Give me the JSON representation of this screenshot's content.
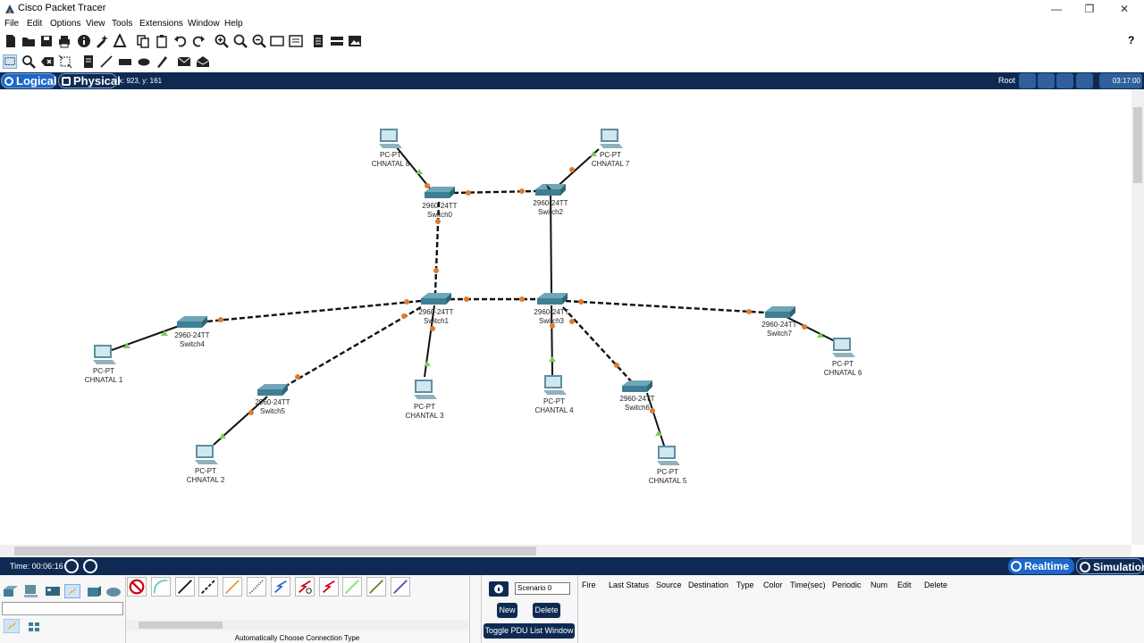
{
  "window": {
    "title": "Cisco Packet Tracer",
    "icon": "packet-tracer-icon",
    "controls": [
      "—",
      "❐",
      "✕"
    ]
  },
  "menu": [
    "File",
    "Edit",
    "Options",
    "View",
    "Tools",
    "Extensions",
    "Window",
    "Help"
  ],
  "viewbar": {
    "logical": "Logical",
    "physical": "Physical",
    "coords": "x: 923, y: 161",
    "root": "Root",
    "clock": "03:17:00"
  },
  "devices": {
    "switches": [
      {
        "model": "2960-24TT",
        "name": "Switch0"
      },
      {
        "model": "2960-24TT",
        "name": "Switch2"
      },
      {
        "model": "2960-24TT",
        "name": "Switch1"
      },
      {
        "model": "2960-24TT",
        "name": "Switch3"
      },
      {
        "model": "2960-24TT",
        "name": "Switch4"
      },
      {
        "model": "2960-24TT",
        "name": "Switch5"
      },
      {
        "model": "2960-24TT",
        "name": "Switch6"
      },
      {
        "model": "2960-24TT",
        "name": "Switch7"
      }
    ],
    "pcs": [
      {
        "model": "PC-PT",
        "name": "CHNATAL 8"
      },
      {
        "model": "PC-PT",
        "name": "CHNATAL 7"
      },
      {
        "model": "PC-PT",
        "name": "CHNATAL 1"
      },
      {
        "model": "PC-PT",
        "name": "CHNATAL 2"
      },
      {
        "model": "PC-PT",
        "name": "CHANTAL 3"
      },
      {
        "model": "PC-PT",
        "name": "CHANTAL 4"
      },
      {
        "model": "PC-PT",
        "name": "CHNATAL 5"
      },
      {
        "model": "PC-PT",
        "name": "CHNATAL 6"
      }
    ]
  },
  "timebar": {
    "time": "Time: 00:06:16",
    "realtime": "Realtime",
    "simulation": "Simulation"
  },
  "bottom": {
    "connection_label": "Automatically Choose Connection Type",
    "scenario": "Scenario 0",
    "new": "New",
    "delete": "Delete",
    "toggle": "Toggle PDU List Window",
    "pdu_columns": [
      "Fire",
      "Last Status",
      "Source",
      "Destination",
      "Type",
      "Color",
      "Time(sec)",
      "Periodic",
      "Num",
      "Edit",
      "Delete"
    ]
  },
  "colors": {
    "navy": "#0e2a52",
    "link_ok": "#7ccf5a",
    "link_blocked": "#e07b2e",
    "help": "?"
  }
}
